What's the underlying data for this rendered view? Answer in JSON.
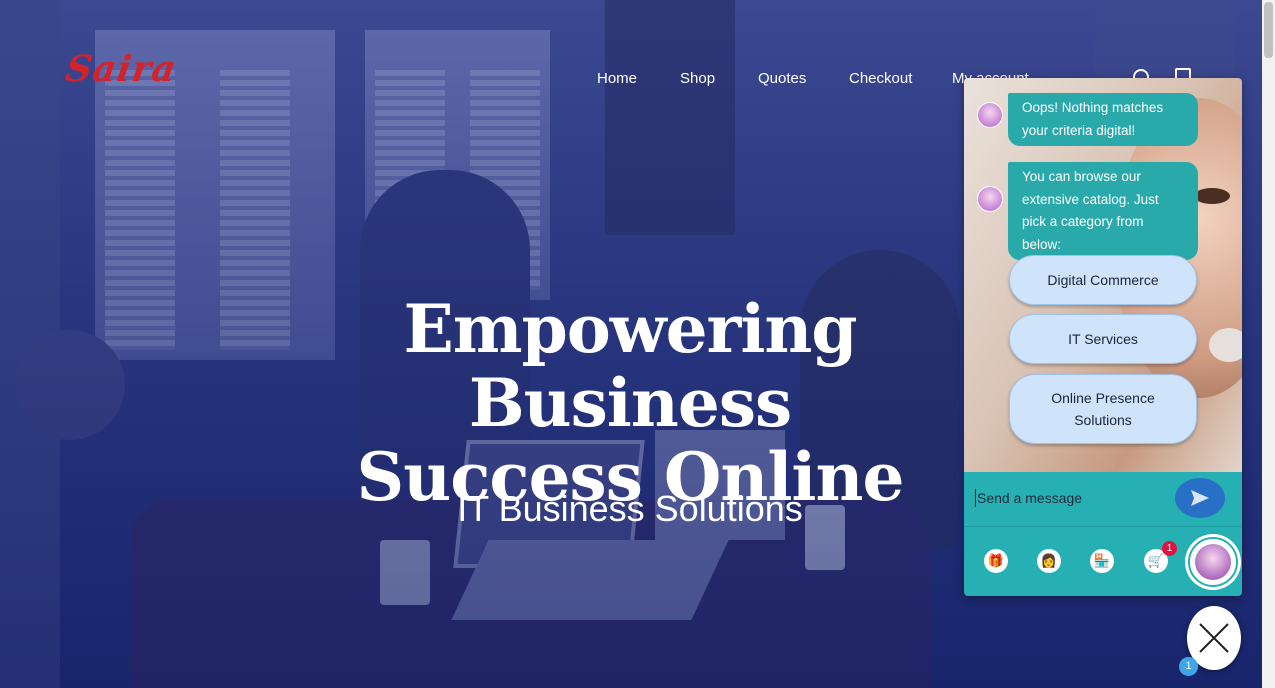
{
  "brand": {
    "logo_text": "Saira",
    "logo_color": "#d4222a"
  },
  "nav": {
    "items": [
      "Home",
      "Shop",
      "Quotes",
      "Checkout",
      "My account"
    ],
    "icons": [
      "search-icon",
      "cart-icon"
    ]
  },
  "hero": {
    "title_line1": "Empowering Business",
    "title_line2": "Success Online",
    "subtitle": "IT Business Solutions"
  },
  "chat": {
    "messages": [
      "Oops! Nothing matches your criteria digital!",
      "You can browse our extensive catalog. Just pick a category from below:"
    ],
    "choices": [
      "Digital Commerce",
      "IT Services",
      "Online Presence Solutions"
    ],
    "input": {
      "placeholder": "Send a message"
    },
    "cart_count": "1",
    "accent_color": "#27b0b4",
    "bubble_color": "#2aa9ab"
  },
  "launcher": {
    "notification_count": "1"
  }
}
